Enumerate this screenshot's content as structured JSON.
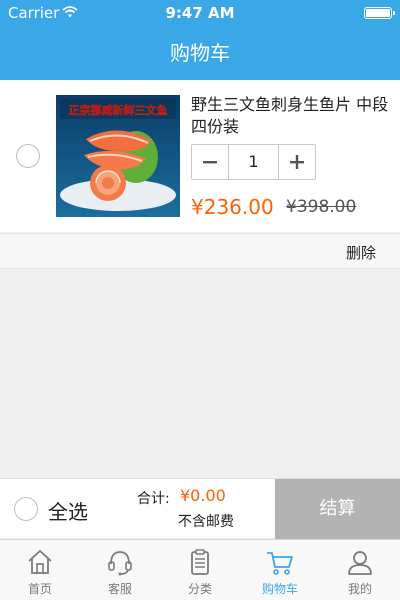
{
  "status_bar": {
    "carrier": "Carrier",
    "time": "9:47 AM"
  },
  "nav": {
    "title": "购物车"
  },
  "cart_items": [
    {
      "name": "野生三文鱼刺身生鱼片 中段 四份装",
      "image_banner": "正宗挪威新鲜三文鱼",
      "quantity": "1",
      "price": "¥236.00",
      "original_price": "¥398.00",
      "delete_label": "删除"
    }
  ],
  "checkout": {
    "select_all_label": "全选",
    "total_label": "合计:",
    "total_value": "¥0.00",
    "shipping_note": "不含邮费",
    "checkout_button": "结算"
  },
  "tabs": [
    {
      "label": "首页",
      "icon": "home-icon"
    },
    {
      "label": "客服",
      "icon": "headset-icon"
    },
    {
      "label": "分类",
      "icon": "clipboard-icon"
    },
    {
      "label": "购物车",
      "icon": "cart-icon",
      "active": true
    },
    {
      "label": "我的",
      "icon": "user-icon"
    }
  ],
  "colors": {
    "accent": "#3aa7e6",
    "price": "#ff6000",
    "checkout_disabled": "#b3b3b3"
  }
}
